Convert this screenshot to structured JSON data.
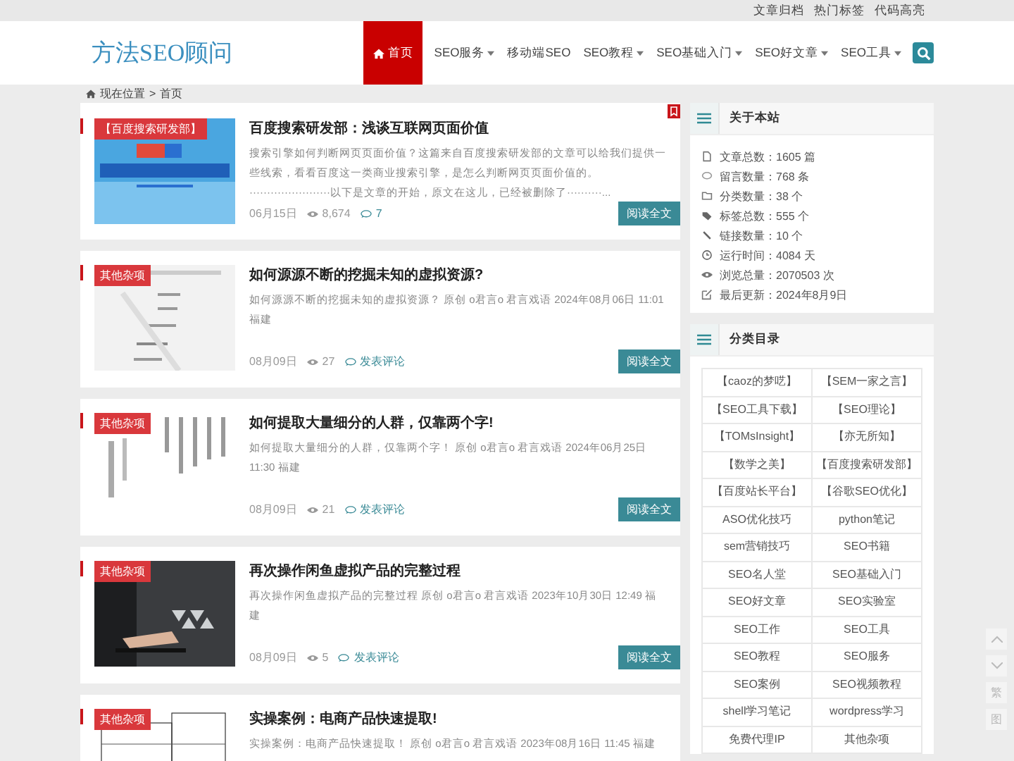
{
  "top_links": [
    "文章归档",
    "热门标签",
    "代码高亮"
  ],
  "logo": "方法SEO顾问",
  "nav": [
    {
      "label": "首页",
      "selected": true,
      "dropdown": false,
      "home": true
    },
    {
      "label": "SEO服务",
      "selected": false,
      "dropdown": true,
      "home": false
    },
    {
      "label": "移动端SEO",
      "selected": false,
      "dropdown": false,
      "home": false
    },
    {
      "label": "SEO教程",
      "selected": false,
      "dropdown": true,
      "home": false
    },
    {
      "label": "SEO基础入门",
      "selected": false,
      "dropdown": true,
      "home": false
    },
    {
      "label": "SEO好文章",
      "selected": false,
      "dropdown": true,
      "home": false
    },
    {
      "label": "SEO工具",
      "selected": false,
      "dropdown": true,
      "home": false
    }
  ],
  "breadcrumb": {
    "label": "现在位置",
    "separator": ">",
    "current": "首页"
  },
  "posts": [
    {
      "tag": "【百度搜索研发部】",
      "title": "百度搜索研发部：浅谈互联网页面价值",
      "excerpt": "搜索引擎如何判断网页页面价值？这篇来自百度搜索研发部的文章可以给我们提供一些线索，看看百度这一类商业搜索引擎，是怎么判断网页页面价值的。 ·······················以下是文章的开始，原文在这儿，已经被删除了··········...",
      "date": "06月15日",
      "views": "8,674",
      "comments": "7",
      "button": "阅读全文",
      "pinned": true
    },
    {
      "tag": "其他杂项",
      "title": "如何源源不断的挖掘未知的虚拟资源?",
      "excerpt": "如何源源不断的挖掘未知的虚拟资源？ 原创 o君言o 君言戏语 2024年08月06日 11:01 福建",
      "date": "08月09日",
      "views": "27",
      "comments": "发表评论",
      "button": "阅读全文",
      "pinned": false
    },
    {
      "tag": "其他杂项",
      "title": "如何提取大量细分的人群，仅靠两个字!",
      "excerpt": "如何提取大量细分的人群，仅靠两个字！ 原创 o君言o 君言戏语 2024年06月25日 11:30 福建",
      "date": "08月09日",
      "views": "21",
      "comments": "发表评论",
      "button": "阅读全文",
      "pinned": false
    },
    {
      "tag": "其他杂项",
      "title": "再次操作闲鱼虚拟产品的完整过程",
      "excerpt": "再次操作闲鱼虚拟产品的完整过程 原创 o君言o 君言戏语 2023年10月30日 12:49 福建",
      "date": "08月09日",
      "views": "5",
      "comments": "发表评论",
      "button": "阅读全文",
      "pinned": false
    },
    {
      "tag": "其他杂项",
      "title": "实操案例：电商产品快速提取!",
      "excerpt": "实操案例：电商产品快速提取！ 原创 o君言o 君言戏语 2023年08月16日 11:45 福建",
      "pinned": false
    }
  ],
  "about": {
    "title": "关于本站",
    "items": [
      {
        "kind": "file",
        "text": "文章总数：1605 篇"
      },
      {
        "kind": "comment",
        "text": "留言数量：768 条"
      },
      {
        "kind": "folder",
        "text": "分类数量：38 个"
      },
      {
        "kind": "tag",
        "text": "标签总数：555 个"
      },
      {
        "kind": "link",
        "text": "链接数量：10 个"
      },
      {
        "kind": "clock",
        "text": "运行时间：4084 天"
      },
      {
        "kind": "eye",
        "text": "浏览总量：2070503 次"
      },
      {
        "kind": "edit",
        "text": "最后更新：2024年8月9日"
      }
    ]
  },
  "categories": {
    "title": "分类目录",
    "items": [
      "【caoz的梦呓】",
      "【SEM一家之言】",
      "【SEO工具下载】",
      "【SEO理论】",
      "【TOMsInsight】",
      "【亦无所知】",
      "【数学之美】",
      "【百度搜索研发部】",
      "【百度站长平台】",
      "【谷歌SEO优化】",
      "ASO优化技巧",
      "python笔记",
      "sem营销技巧",
      "SEO书籍",
      "SEO名人堂",
      "SEO基础入门",
      "SEO好文章",
      "SEO实验室",
      "SEO工作",
      "SEO工具",
      "SEO教程",
      "SEO服务",
      "SEO案例",
      "SEO视频教程",
      "shell学习笔记",
      "wordpress学习",
      "免费代理IP",
      "其他杂项"
    ]
  },
  "float_tools": [
    "繁",
    "图"
  ]
}
